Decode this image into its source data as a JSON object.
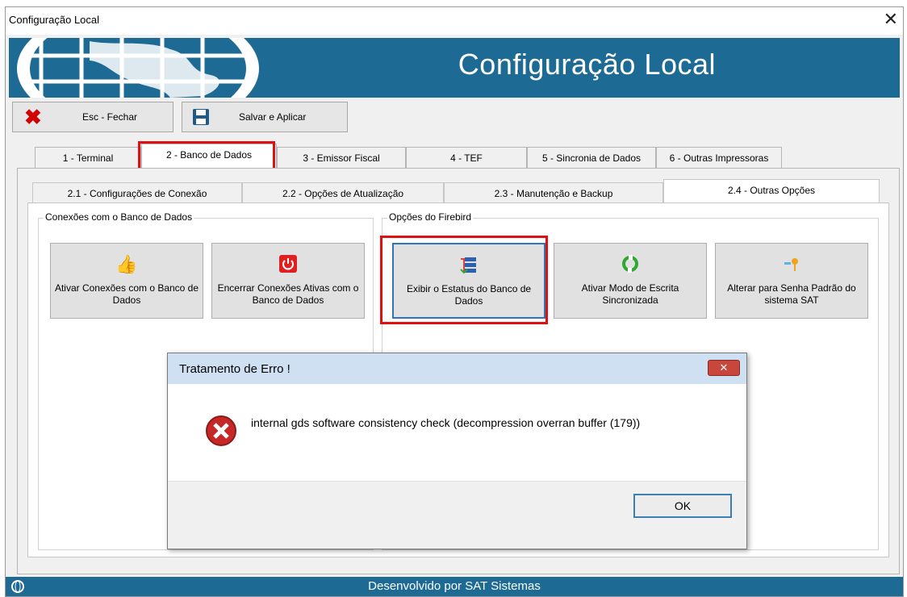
{
  "window": {
    "title": "Configuração Local",
    "close_glyph": "✕"
  },
  "banner": {
    "title": "Configuração Local"
  },
  "toolbar": {
    "close_label": "Esc - Fechar",
    "save_label": "Salvar e Aplicar"
  },
  "tabs": [
    {
      "label": "1 - Terminal"
    },
    {
      "label": "2 - Banco de Dados"
    },
    {
      "label": "3 - Emissor Fiscal"
    },
    {
      "label": "4 - TEF"
    },
    {
      "label": "5 - Sincronia de Dados"
    },
    {
      "label": "6 - Outras Impressoras"
    }
  ],
  "subtabs": [
    {
      "label": "2.1 - Configurações de Conexão"
    },
    {
      "label": "2.2 - Opções de Atualização"
    },
    {
      "label": "2.3 - Manutenção e Backup"
    },
    {
      "label": "2.4 - Outras Opções"
    }
  ],
  "groups": {
    "connections": {
      "title": "Conexões com o Banco de Dados",
      "buttons": [
        {
          "label": "Ativar Conexões com o Banco de Dados",
          "icon": "thumbs-up-icon"
        },
        {
          "label": "Encerrar Conexões Ativas com o Banco de Dados",
          "icon": "power-icon"
        }
      ]
    },
    "firebird": {
      "title": "Opções do Firebird",
      "buttons": [
        {
          "label": "Exibir o Estatus do Banco de Dados",
          "icon": "database-status-icon"
        },
        {
          "label": "Ativar Modo de Escrita Sincronizada",
          "icon": "sync-icon"
        },
        {
          "label": "Alterar para Senha Padrão do sistema SAT",
          "icon": "key-icon"
        }
      ]
    }
  },
  "footer": {
    "text": "Desenvolvido por SAT Sistemas"
  },
  "dialog": {
    "title": "Tratamento de Erro !",
    "message": "internal gds software consistency check (decompression overran buffer (179))",
    "ok_label": "OK",
    "close_glyph": "✕",
    "icon": "error-icon"
  },
  "colors": {
    "banner": "#1d6a94",
    "highlight": "#e01010"
  }
}
